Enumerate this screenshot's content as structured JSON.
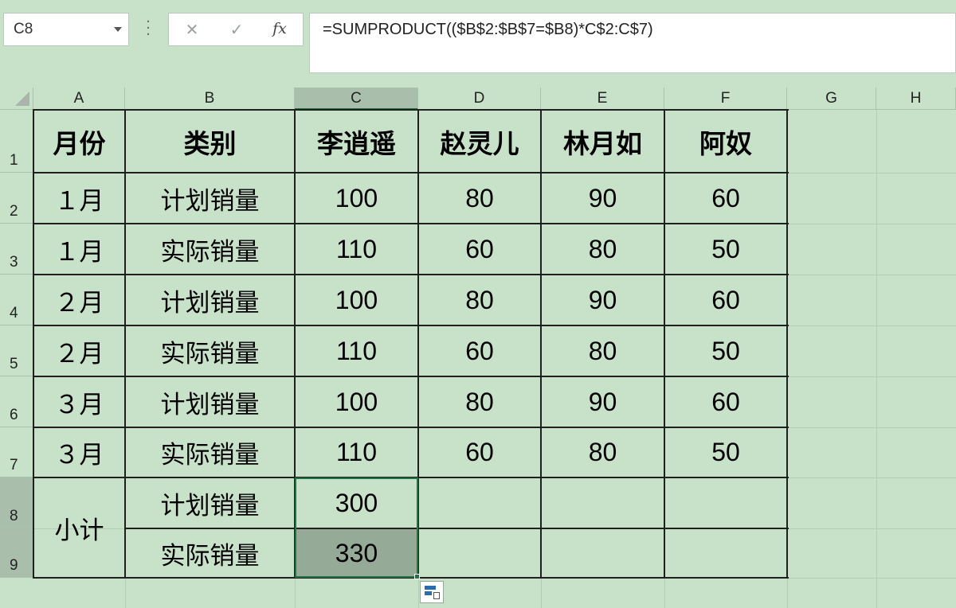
{
  "name_box": {
    "value": "C8"
  },
  "formula_bar": {
    "cancel_icon": "✕",
    "enter_icon": "✓",
    "function_icon": "fx",
    "formula": "=SUMPRODUCT(($B$2:$B$7=$B8)*C$2:C$7)"
  },
  "columns": [
    "A",
    "B",
    "C",
    "D",
    "E",
    "F",
    "G",
    "H"
  ],
  "rows": [
    "1",
    "2",
    "3",
    "4",
    "5",
    "6",
    "7",
    "8",
    "9"
  ],
  "selection": {
    "active_column": "C",
    "active_rows": [
      "8",
      "9"
    ]
  },
  "table": {
    "headers": [
      "月份",
      "类别",
      "李逍遥",
      "赵灵儿",
      "林月如",
      "阿奴"
    ],
    "data_rows": [
      [
        "１月",
        "计划销量",
        "100",
        "80",
        "90",
        "60"
      ],
      [
        "１月",
        "实际销量",
        "110",
        "60",
        "80",
        "50"
      ],
      [
        "２月",
        "计划销量",
        "100",
        "80",
        "90",
        "60"
      ],
      [
        "２月",
        "实际销量",
        "110",
        "60",
        "80",
        "50"
      ],
      [
        "３月",
        "计划销量",
        "100",
        "80",
        "90",
        "60"
      ],
      [
        "３月",
        "实际销量",
        "110",
        "60",
        "80",
        "50"
      ]
    ],
    "subtotal": {
      "label": "小计",
      "rows": [
        {
          "category": "计划销量",
          "value": "300"
        },
        {
          "category": "实际销量",
          "value": "330"
        }
      ]
    }
  }
}
